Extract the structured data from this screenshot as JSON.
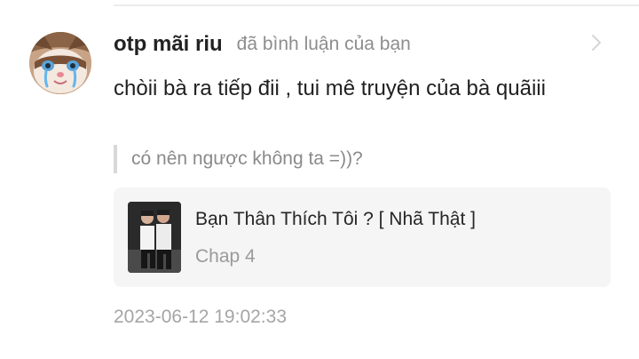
{
  "comment": {
    "username": "otp mãi riu",
    "action": "đã bình luận của bạn",
    "text": "chòii bà ra tiếp đii , tui mê truyện của bà quãiii",
    "quoted_reply": "có nên ngược không ta =))?",
    "timestamp": "2023-06-12 19:02:33"
  },
  "story": {
    "title": "Bạn Thân Thích Tôi ? [ Nhã Thật ]",
    "chapter": "Chap 4"
  },
  "icons": {
    "avatar": "cat-avatar-icon",
    "chevron": "chevron-right-icon",
    "cover": "story-cover-image"
  },
  "colors": {
    "username": "#222222",
    "secondary_text": "#8d8d8d",
    "card_background": "#f5f5f5",
    "quote_bar": "#d8d8d8"
  }
}
